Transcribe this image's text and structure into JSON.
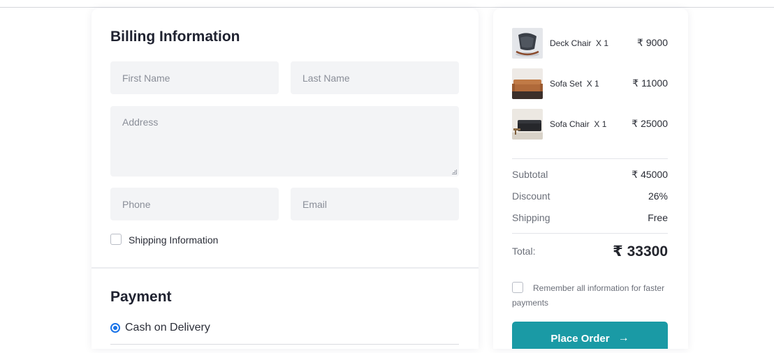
{
  "billing": {
    "title": "Billing Information",
    "first_name_placeholder": "First Name",
    "last_name_placeholder": "Last Name",
    "address_placeholder": "Address",
    "phone_placeholder": "Phone",
    "email_placeholder": "Email",
    "shipping_checkbox_label": "Shipping Information"
  },
  "payment": {
    "title": "Payment",
    "option_label": "Cash on Delivery"
  },
  "cart": {
    "items": [
      {
        "name": "Deck Chair",
        "qty": "X 1",
        "price": "₹ 9000"
      },
      {
        "name": "Sofa Set",
        "qty": "X 1",
        "price": "₹ 11000"
      },
      {
        "name": "Sofa Chair",
        "qty": "X 1",
        "price": "₹ 25000"
      }
    ]
  },
  "summary": {
    "subtotal_label": "Subtotal",
    "subtotal_value": "₹ 45000",
    "discount_label": "Discount",
    "discount_value": "26%",
    "shipping_label": "Shipping",
    "shipping_value": "Free",
    "total_label": "Total:",
    "total_value": "₹ 33300",
    "remember_label": "Remember all information for faster payments",
    "place_order_label": "Place Order"
  },
  "colors": {
    "accent": "#1a9aa5",
    "radio": "#1a73e8",
    "field_bg": "#f3f4f6"
  },
  "icons": {
    "arrow": "arrow-right-icon"
  }
}
